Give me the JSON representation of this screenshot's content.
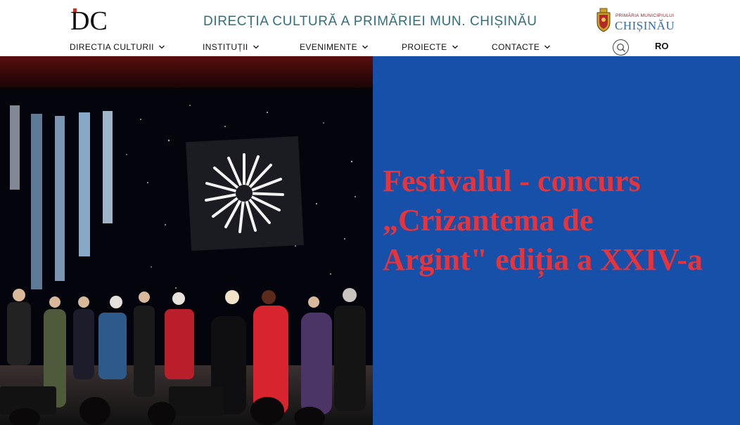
{
  "header": {
    "logo_text": "DC",
    "site_title": "DIRECȚIA CULTURĂ A PRIMĂRIEI MUN. CHIȘINĂU",
    "crest_small": "PRIMĂRIA MUNICIPIULUI",
    "crest_big": "CHIȘINĂU",
    "language": "RO"
  },
  "nav": {
    "items": [
      {
        "label": "DIRECTIA CULTURII"
      },
      {
        "label": "INSTITUȚII"
      },
      {
        "label": "EVENIMENTE"
      },
      {
        "label": "PROIECTE"
      },
      {
        "label": "CONTACTE"
      }
    ]
  },
  "hero": {
    "title_lines": [
      "Festivalul - concurs",
      "„Crizantema de",
      "Argint\" ediția a XXIV-a"
    ]
  },
  "colors": {
    "title_blue": "#2f6f80",
    "panel_blue": "#1650a8",
    "title_red": "#e8333a"
  }
}
